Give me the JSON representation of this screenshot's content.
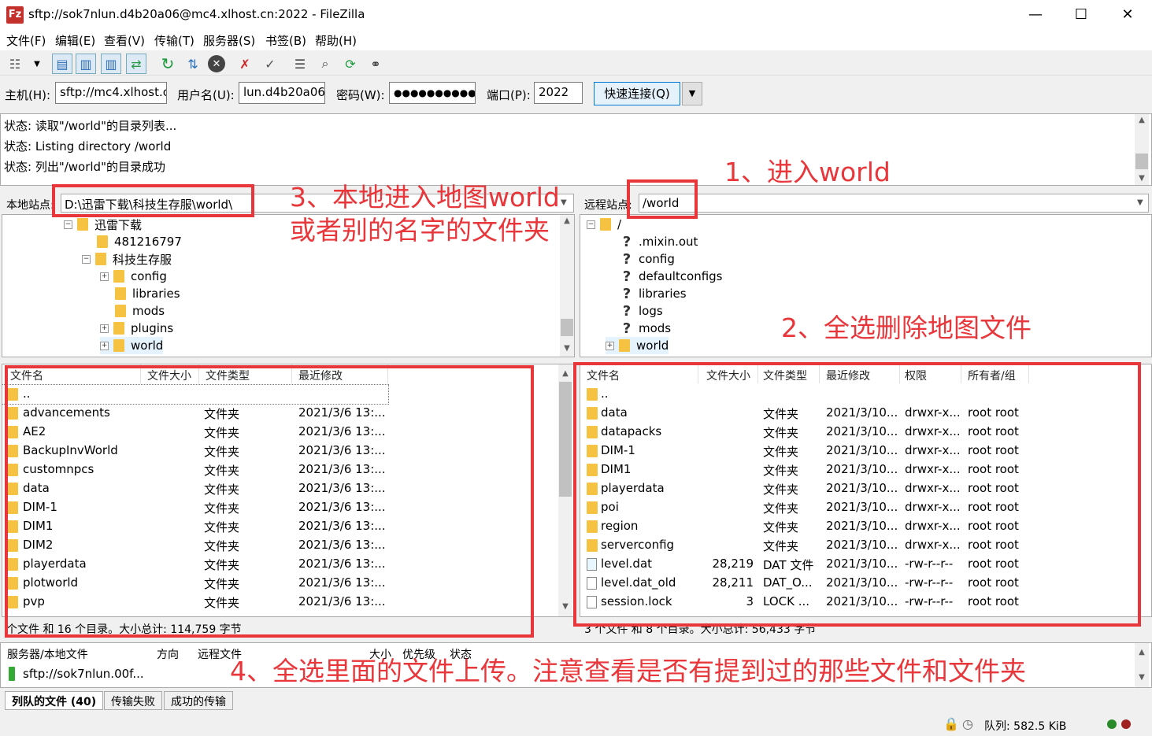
{
  "window": {
    "title": "sftp://sok7nlun.d4b20a06@mc4.xlhost.cn:2022 - FileZilla",
    "app_icon": "filezilla-icon",
    "minimize": "—",
    "maximize": "☐",
    "close": "✕"
  },
  "menu": [
    "文件(F)",
    "编辑(E)",
    "查看(V)",
    "传输(T)",
    "服务器(S)",
    "书签(B)",
    "帮助(H)"
  ],
  "quickconnect": {
    "host_label": "主机(H):",
    "host_value": "sftp://mc4.xlhost.c",
    "user_label": "用户名(U):",
    "user_value": "lun.d4b20a06",
    "pass_label": "密码(W):",
    "pass_value": "●●●●●●●●●●",
    "port_label": "端口(P):",
    "port_value": "2022",
    "connect_button": "快速连接(Q)",
    "dropdown": "▼"
  },
  "log": [
    "状态:  读取\"/world\"的目录列表...",
    "状态:  Listing directory /world",
    "状态:  列出\"/world\"的目录成功"
  ],
  "local": {
    "site_label": "本地站点:",
    "path": "D:\\迅雷下载\\科技生存服\\world\\",
    "tree": [
      "迅雷下载",
      "481216797",
      "科技生存服",
      "config",
      "libraries",
      "mods",
      "plugins",
      "world"
    ],
    "headers": [
      "文件名",
      "文件大小",
      "文件类型",
      "最近修改"
    ],
    "files": [
      {
        "name": "..",
        "size": "",
        "type": "",
        "modified": ""
      },
      {
        "name": "advancements",
        "size": "",
        "type": "文件夹",
        "modified": "2021/3/6 13:..."
      },
      {
        "name": "AE2",
        "size": "",
        "type": "文件夹",
        "modified": "2021/3/6 13:..."
      },
      {
        "name": "BackupInvWorld",
        "size": "",
        "type": "文件夹",
        "modified": "2021/3/6 13:..."
      },
      {
        "name": "customnpcs",
        "size": "",
        "type": "文件夹",
        "modified": "2021/3/6 13:..."
      },
      {
        "name": "data",
        "size": "",
        "type": "文件夹",
        "modified": "2021/3/6 13:..."
      },
      {
        "name": "DIM-1",
        "size": "",
        "type": "文件夹",
        "modified": "2021/3/6 13:..."
      },
      {
        "name": "DIM1",
        "size": "",
        "type": "文件夹",
        "modified": "2021/3/6 13:..."
      },
      {
        "name": "DIM2",
        "size": "",
        "type": "文件夹",
        "modified": "2021/3/6 13:..."
      },
      {
        "name": "playerdata",
        "size": "",
        "type": "文件夹",
        "modified": "2021/3/6 13:..."
      },
      {
        "name": "plotworld",
        "size": "",
        "type": "文件夹",
        "modified": "2021/3/6 13:..."
      },
      {
        "name": "pvp",
        "size": "",
        "type": "文件夹",
        "modified": "2021/3/6 13:..."
      }
    ],
    "status": "个文件 和 16 个目录。大小总计: 114,759 字节"
  },
  "remote": {
    "site_label": "远程站点:",
    "path": "/world",
    "tree": [
      "/",
      ".mixin.out",
      "config",
      "defaultconfigs",
      "libraries",
      "logs",
      "mods",
      "world"
    ],
    "headers": [
      "文件名",
      "文件大小",
      "文件类型",
      "最近修改",
      "权限",
      "所有者/组"
    ],
    "files": [
      {
        "name": "..",
        "size": "",
        "type": "",
        "modified": "",
        "perm": "",
        "owner": "",
        "icon": "folder"
      },
      {
        "name": "data",
        "size": "",
        "type": "文件夹",
        "modified": "2021/3/10...",
        "perm": "drwxr-x...",
        "owner": "root root",
        "icon": "folder"
      },
      {
        "name": "datapacks",
        "size": "",
        "type": "文件夹",
        "modified": "2021/3/10...",
        "perm": "drwxr-x...",
        "owner": "root root",
        "icon": "folder"
      },
      {
        "name": "DIM-1",
        "size": "",
        "type": "文件夹",
        "modified": "2021/3/10...",
        "perm": "drwxr-x...",
        "owner": "root root",
        "icon": "folder"
      },
      {
        "name": "DIM1",
        "size": "",
        "type": "文件夹",
        "modified": "2021/3/10...",
        "perm": "drwxr-x...",
        "owner": "root root",
        "icon": "folder"
      },
      {
        "name": "playerdata",
        "size": "",
        "type": "文件夹",
        "modified": "2021/3/10...",
        "perm": "drwxr-x...",
        "owner": "root root",
        "icon": "folder"
      },
      {
        "name": "poi",
        "size": "",
        "type": "文件夹",
        "modified": "2021/3/10...",
        "perm": "drwxr-x...",
        "owner": "root root",
        "icon": "folder"
      },
      {
        "name": "region",
        "size": "",
        "type": "文件夹",
        "modified": "2021/3/10...",
        "perm": "drwxr-x...",
        "owner": "root root",
        "icon": "folder"
      },
      {
        "name": "serverconfig",
        "size": "",
        "type": "文件夹",
        "modified": "2021/3/10...",
        "perm": "drwxr-x...",
        "owner": "root root",
        "icon": "folder"
      },
      {
        "name": "level.dat",
        "size": "28,219",
        "type": "DAT 文件",
        "modified": "2021/3/10...",
        "perm": "-rw-r--r--",
        "owner": "root root",
        "icon": "dat"
      },
      {
        "name": "level.dat_old",
        "size": "28,211",
        "type": "DAT_O...",
        "modified": "2021/3/10...",
        "perm": "-rw-r--r--",
        "owner": "root root",
        "icon": "file"
      },
      {
        "name": "session.lock",
        "size": "3",
        "type": "LOCK ...",
        "modified": "2021/3/10...",
        "perm": "-rw-r--r--",
        "owner": "root root",
        "icon": "file"
      }
    ],
    "status": "3 个文件 和 8 个目录。大小总计: 56,433 字节"
  },
  "queue": {
    "headers": [
      "服务器/本地文件",
      "方向",
      "远程文件",
      "大小",
      "优先级",
      "状态"
    ],
    "row": "sftp://sok7nlun.00f..."
  },
  "tabs": [
    "列队的文件 (40)",
    "传输失败",
    "成功的传输"
  ],
  "statusbar": {
    "queue": "队列: 582.5 KiB"
  },
  "annotations": {
    "a1": "1、进入world",
    "a2": "2、全选删除地图文件",
    "a3_line1": "3、本地进入地图world",
    "a3_line2": "或者别的名字的文件夹",
    "a4": "4、全选里面的文件上传。注意查看是否有提到过的那些文件和文件夹"
  },
  "colors": {
    "annotation": "#e8363a",
    "folder": "#f5c242",
    "accent": "#0078d7"
  }
}
